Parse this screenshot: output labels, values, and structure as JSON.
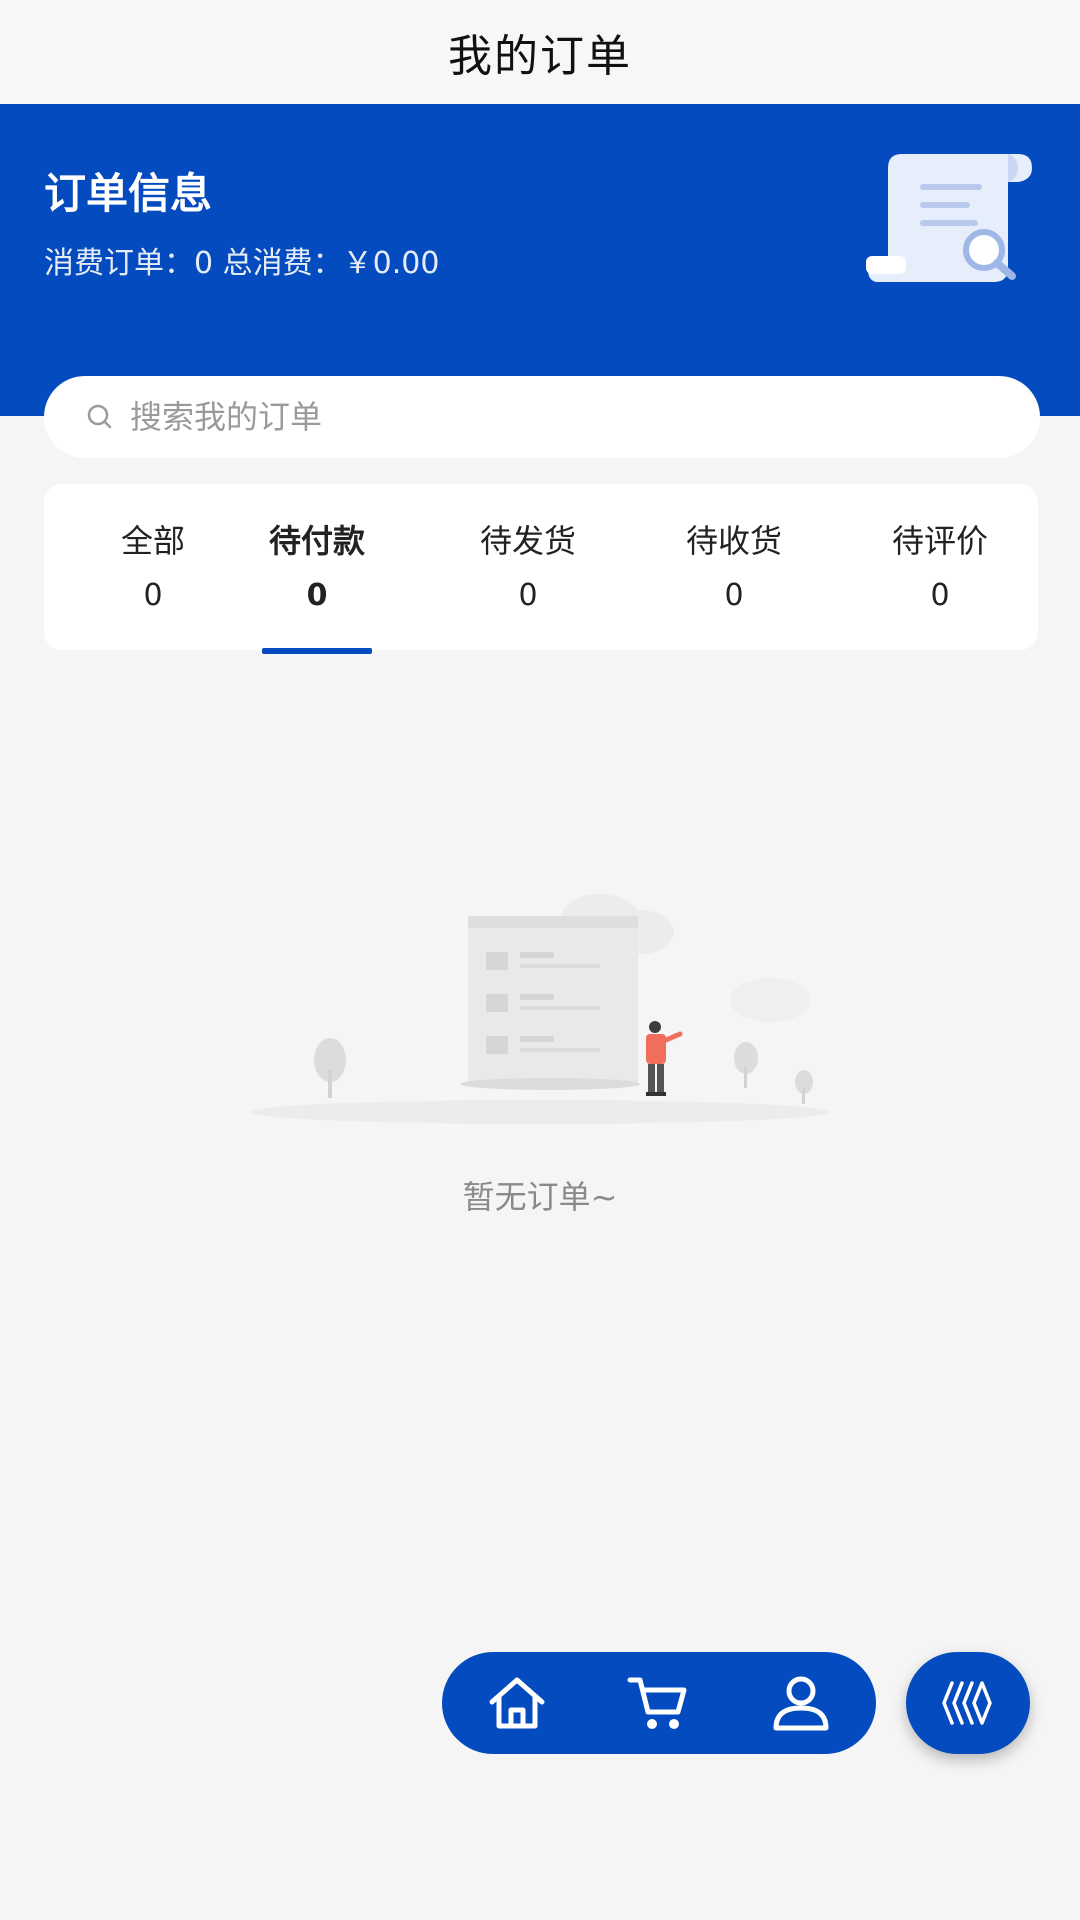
{
  "header": {
    "title": "我的订单"
  },
  "banner": {
    "title": "订单信息",
    "summary": "消费订单：0 总消费：￥0.00"
  },
  "search": {
    "placeholder": "搜索我的订单",
    "icon": "search-icon"
  },
  "tabs": [
    {
      "label": "全部",
      "count": "0"
    },
    {
      "label": "待付款",
      "count": "0"
    },
    {
      "label": "待发货",
      "count": "0"
    },
    {
      "label": "待收货",
      "count": "0"
    },
    {
      "label": "待评价",
      "count": "0"
    }
  ],
  "active_tab": "待付款",
  "empty_state": {
    "text": "暂无订单~"
  },
  "bottom_nav": {
    "items": [
      {
        "icon": "home-icon"
      },
      {
        "icon": "cart-icon"
      },
      {
        "icon": "user-icon"
      }
    ],
    "fab_icon": "chevron-stack-icon"
  },
  "colors": {
    "primary": "#034bbe",
    "background": "#f5f5f5",
    "muted_text": "#8a8a8a"
  }
}
